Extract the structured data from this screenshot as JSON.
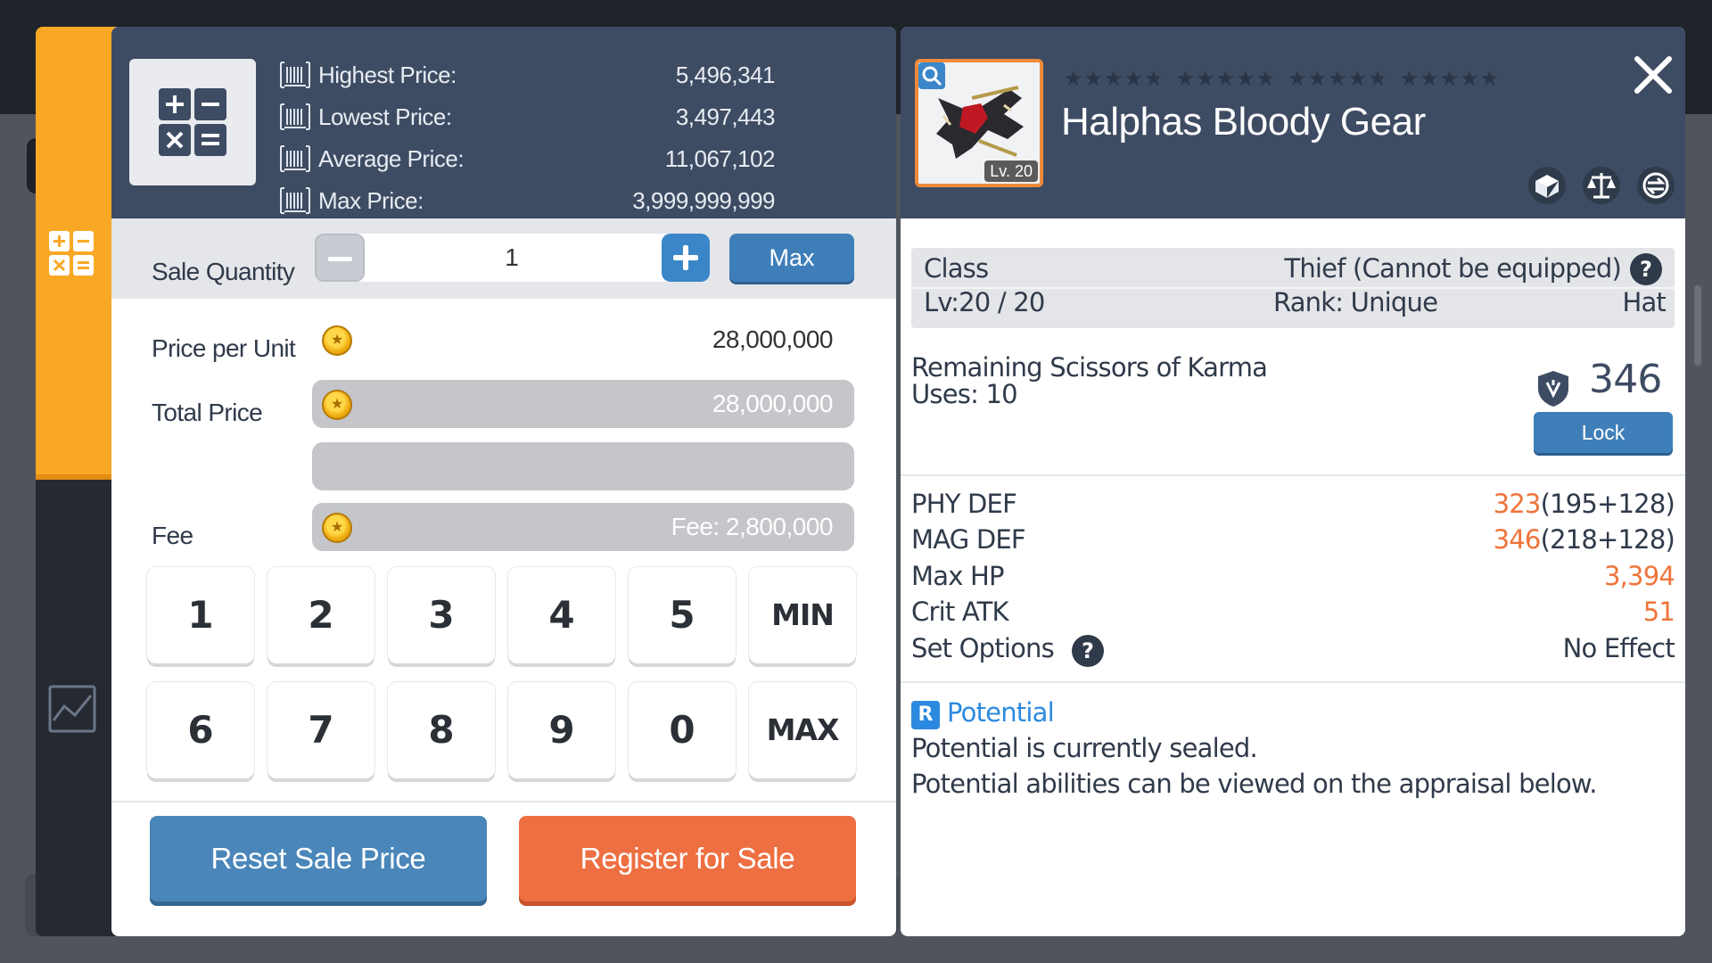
{
  "sell_panel": {
    "market_prices": [
      {
        "label": "Highest Price:",
        "value": "5,496,341"
      },
      {
        "label": "Lowest Price:",
        "value": "3,497,443"
      },
      {
        "label": "Average Price:",
        "value": "11,067,102"
      },
      {
        "label": "Max Price:",
        "value": "3,999,999,999"
      }
    ],
    "sale_quantity_label": "Sale Quantity",
    "quantity": "1",
    "max_label": "Max",
    "price_per_unit_label": "Price per Unit",
    "price_per_unit": "28,000,000",
    "total_price_label": "Total Price",
    "total_price": "28,000,000",
    "fee_label": "Fee",
    "fee": "Fee: 2,800,000",
    "keypad": {
      "row1": [
        "1",
        "2",
        "3",
        "4",
        "5",
        "MIN"
      ],
      "row2": [
        "6",
        "7",
        "8",
        "9",
        "0",
        "MAX"
      ]
    },
    "reset_label": "Reset Sale Price",
    "register_label": "Register for Sale"
  },
  "item": {
    "name": "Halphas Bloody Gear",
    "level_badge": "Lv. 20",
    "star_groups": 4,
    "stars_per_group": 5,
    "class_label": "Class",
    "class_value": "Thief (Cannot be equipped)",
    "level": "Lv:20 / 20",
    "rank": "Rank: Unique",
    "slot": "Hat",
    "karma_label": "Remaining Scissors of Karma",
    "karma_uses": "Uses: 10",
    "power": "346",
    "lock_label": "Lock",
    "stats": [
      {
        "label": "PHY DEF",
        "value": "323",
        "detail": "(195+128)"
      },
      {
        "label": "MAG DEF",
        "value": "346",
        "detail": "(218+128)"
      },
      {
        "label": "Max HP",
        "value": "3,394",
        "detail": ""
      },
      {
        "label": "Crit ATK",
        "value": "51",
        "detail": ""
      }
    ],
    "set_options_label": "Set Options",
    "set_options_value": "No Effect",
    "potential_badge": "R",
    "potential_title": "Potential",
    "potential_line1": "Potential is currently sealed.",
    "potential_line2": "Potential abilities can be viewed on the appraisal below."
  },
  "colors": {
    "header": "#3e4c63",
    "accent_orange": "#f9a826",
    "register": "#ee6f42",
    "reset": "#4a86ba",
    "stat_value": "#f0743a",
    "potential": "#2b8ae0"
  },
  "icons": [
    "calculator-icon",
    "chart-icon",
    "barcode-icon",
    "coin-icon",
    "magnify-icon",
    "close-icon",
    "trade-icon",
    "scale-icon",
    "transfer-icon",
    "shield-icon",
    "help-icon"
  ]
}
